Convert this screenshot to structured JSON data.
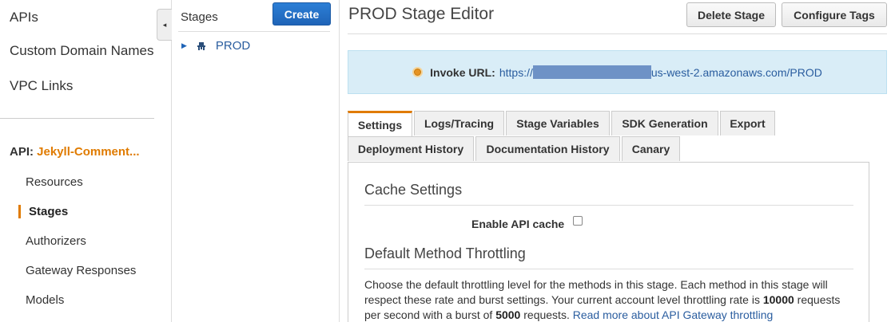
{
  "left_nav": {
    "top_items": [
      "APIs",
      "Custom Domain Names",
      "VPC Links"
    ],
    "api_prefix": "API:",
    "api_name": "Jekyll-Comment...",
    "sub_items": [
      "Resources",
      "Stages",
      "Authorizers",
      "Gateway Responses",
      "Models"
    ],
    "active_item": "Stages",
    "collapse_icon": "◂"
  },
  "stages": {
    "label": "Stages",
    "create_label": "Create",
    "tree": [
      {
        "caret": "▶",
        "icon": "stage-icon",
        "label": "PROD"
      }
    ]
  },
  "editor": {
    "title": "PROD Stage Editor",
    "delete_label": "Delete Stage",
    "configure_tags_label": "Configure Tags",
    "invoke_label": "Invoke URL:",
    "invoke_url_prefix": "https://",
    "invoke_url_suffix": "us-west-2.amazonaws.com/PROD",
    "tabs_row1": [
      "Settings",
      "Logs/Tracing",
      "Stage Variables",
      "SDK Generation",
      "Export"
    ],
    "tabs_row2": [
      "Deployment History",
      "Documentation History",
      "Canary"
    ],
    "active_tab": "Settings",
    "cache_title": "Cache Settings",
    "cache_label": "Enable API cache",
    "cache_enabled": false,
    "throttle_title": "Default Method Throttling",
    "throttle_text_1": "Choose the default throttling level for the methods in this stage. Each method in this stage will respect these rate and burst settings. Your current account level throttling rate is ",
    "throttle_rate": "10000",
    "throttle_text_2": " requests per second with a burst of ",
    "throttle_burst": "5000",
    "throttle_text_3": " requests. ",
    "throttle_link": "Read more about API Gateway throttling"
  },
  "colors": {
    "accent": "#e07b00",
    "link": "#2a5d9f",
    "invoke_bg": "#d9edf7",
    "primary_btn": "#1f64b7"
  }
}
